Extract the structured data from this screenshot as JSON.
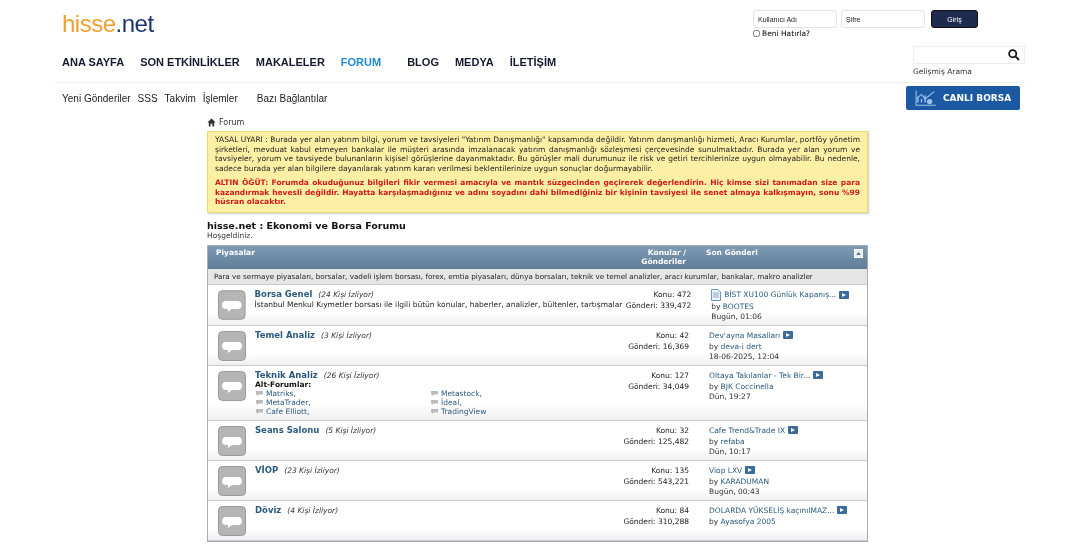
{
  "logo": {
    "name": "hisse",
    "tld": ".net"
  },
  "login": {
    "username_placeholder": "Kullanıcı Adı",
    "password_placeholder": "Şifre",
    "button": "Giriş",
    "remember": {
      "label": "Beni Hatırla?",
      "checked": false
    }
  },
  "nav": [
    {
      "label": "ANA SAYFA",
      "selected": false
    },
    {
      "label": "SON ETKİNLİKLER",
      "selected": false
    },
    {
      "label": "MAKALELER",
      "selected": false
    },
    {
      "label": "FORUM",
      "selected": true
    },
    {
      "label": "BLOG",
      "selected": false
    },
    {
      "label": "MEDYA",
      "selected": false
    },
    {
      "label": "İLETİŞİM",
      "selected": false
    }
  ],
  "search": {
    "advanced": "Gelişmiş Arama"
  },
  "subnav": [
    "Yeni Gönderiler",
    "SSS",
    "Takvim",
    "İşlemler",
    "Bazı Bağlantılar"
  ],
  "live_button": "CANLI BORSA",
  "breadcrumb": "Forum",
  "notice": {
    "text": "YASAL UYARI : Burada yer alan yatırım bilgi, yorum ve tavsiyeleri \"Yatırım Danışmanlığı\" kapsamında değildir. Yatırım danışmanlığı hizmeti, Aracı Kurumlar, portföy yönetim şirketleri, mevduat kabul etmeyen bankalar ile müşteri arasında imzalanacak yatırım danışmanlığı sözleşmesi çerçevesinde sunulmaktadır. Burada yer alan yorum ve tavsiyeler, yorum ve tavsiyede bulunanların kişisel görüşlerine dayanmaktadır. Bu görüşler mali durumunuz ile risk ve getiri tercihlerinize uygun olmayabilir. Bu nedenle, sadece burada yer alan bilgilere dayanılarak yatırım kararı verilmesi beklentilerinize uygun sonuçlar doğurmayabilir.",
    "advice": "ALTIN ÖĞÜT: Forumda okuduğunuz bilgileri fikir vermesi amacıyla ve mantık süzgecinden geçirerek değerlendirin. Hiç kimse sizi tanımadan size para kazandırmak hevesli değildir. Hayatta karşılaşmadığınız ve adını soyadını dahi bilmediğiniz bir kişinin tavsiyesi ile senet almaya kalkışmayın, sonu %99 hüsran olacaktır."
  },
  "forum": {
    "title": "hisse.net : Ekonomi ve Borsa Forumu",
    "welcome": "Hoşgeldiniz."
  },
  "category": {
    "title": "Piyasalar",
    "columns": [
      "Konular / Gönderiler",
      "Son Gönderi"
    ],
    "description": "Para ve sermaye piyasaları, borsalar, vadeli işlem borsası, forex, emtia piyasaları, dünya borsaları, teknik ve temel analizler, aracı kurumlar, bankalar, makro analizler",
    "forums": [
      {
        "name": "Borsa Genel",
        "watching": "(24 Kişi İzliyor)",
        "description": "İstanbul Menkul Kıymetler borsası ile ilgili bütün konular, haberler, analizler, bültenler, tartışmalar",
        "topics": "Konu: 472",
        "posts": "Gönderi: 339,472",
        "last_post": {
          "doc_icon": true,
          "title": "BİST XU100 Günlük Kapanış...",
          "by": "by",
          "user": "BOOTES",
          "time": "Bugün, 01:06"
        }
      },
      {
        "name": "Temel Analiz",
        "watching": "(3 Kişi İzliyor)",
        "topics": "Konu: 42",
        "posts": "Gönderi: 16,369",
        "last_post": {
          "doc_icon": false,
          "title": "Dev'ayna Masalları",
          "by": "by",
          "user": "deva-i dert",
          "time": "18-06-2025, 12:04"
        }
      },
      {
        "name": "Teknik Analiz",
        "watching": "(26 Kişi İzliyor)",
        "subforums_label": "Alt-Forumlar:",
        "subforums": [
          "Matriks,",
          "MetaTrader,",
          "Cafe Elliott,",
          "Metastock,",
          "İdeal,",
          "TradingView"
        ],
        "topics": "Konu: 127",
        "posts": "Gönderi: 34,049",
        "last_post": {
          "doc_icon": false,
          "title": "Oltaya Takılanlar - Tek Bir...",
          "by": "by",
          "user": "BJK Coccinella",
          "time": "Dün, 19:27"
        }
      },
      {
        "name": "Seans Salonu",
        "watching": "(5 Kişi İzliyor)",
        "topics": "Konu: 32",
        "posts": "Gönderi: 125,482",
        "last_post": {
          "doc_icon": false,
          "title": "Cafe Trend&Trade IX",
          "by": "by",
          "user": "refaba",
          "time": "Dün, 10:17"
        }
      },
      {
        "name": "VİOP",
        "watching": "(23 Kişi İzliyor)",
        "topics": "Konu: 135",
        "posts": "Gönderi: 543,221",
        "last_post": {
          "doc_icon": false,
          "title": "Viop LXV",
          "by": "by",
          "user": "KARADUMAN",
          "time": "Bugün, 00:43"
        }
      },
      {
        "name": "Döviz",
        "watching": "(4 Kişi İzliyor)",
        "topics": "Konu: 84",
        "posts": "Gönderi: 310,288",
        "last_post": {
          "doc_icon": false,
          "title": "DOLARDA YÜKSELİŞ kaçınılMAZ...",
          "by": "by",
          "user": "Ayasofya 2005"
        }
      }
    ]
  }
}
